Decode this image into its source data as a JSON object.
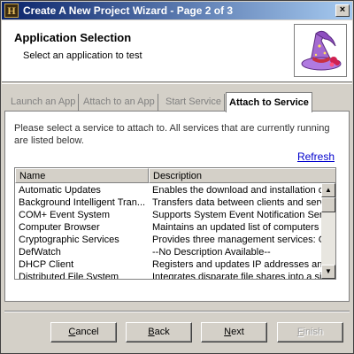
{
  "window": {
    "title": "Create A New Project Wizard - Page 2 of 3",
    "close_glyph": "×"
  },
  "header": {
    "title": "Application Selection",
    "subtitle": "Select an application to test",
    "icon": "wizard-hat-icon"
  },
  "tabs": [
    {
      "label": "Launch an App",
      "active": false
    },
    {
      "label": "Attach to an App",
      "active": false
    },
    {
      "label": "Start Service",
      "active": false
    },
    {
      "label": "Attach to Service",
      "active": true
    }
  ],
  "panel": {
    "description": "Please select a service to attach to.  All services that are currently running are listed below.",
    "refresh_label": "Refresh"
  },
  "services_list": {
    "columns": [
      "Name",
      "Description"
    ],
    "rows": [
      {
        "name": "Automatic Updates",
        "description": "Enables the download and installation of"
      },
      {
        "name": "Background Intelligent Tran...",
        "description": "Transfers data between clients and serve"
      },
      {
        "name": "COM+ Event System",
        "description": "Supports System Event Notification Servi"
      },
      {
        "name": "Computer Browser",
        "description": "Maintains an updated list of computers or"
      },
      {
        "name": "Cryptographic Services",
        "description": "Provides three management services: Ca"
      },
      {
        "name": "DefWatch",
        "description": "--No Description Available--"
      },
      {
        "name": "DHCP Client",
        "description": "Registers and updates IP addresses and"
      },
      {
        "name": "Distributed File System",
        "description": "Integrates disparate file shares into a sin"
      }
    ]
  },
  "buttons": {
    "cancel": {
      "label": "Cancel",
      "accel": "C",
      "rest": "ancel"
    },
    "back": {
      "label": "Back",
      "accel": "B",
      "rest": "ack"
    },
    "next": {
      "label": "Next",
      "accel": "N",
      "rest": "ext"
    },
    "finish": {
      "label": "Finish",
      "accel": "F",
      "rest": "inish",
      "disabled": true
    }
  },
  "colors": {
    "titlebar_start": "#0a246a",
    "titlebar_end": "#a6caf0",
    "link": "#0000cc",
    "face": "#d4d0c8"
  }
}
